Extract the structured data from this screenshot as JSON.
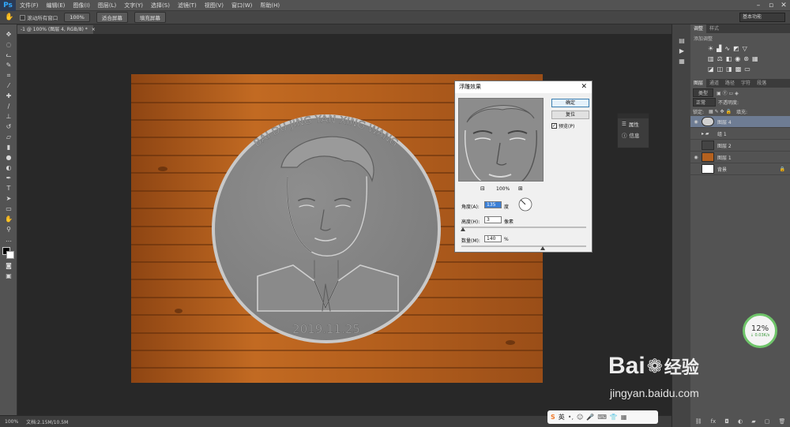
{
  "app": {
    "logo": "Ps"
  },
  "menu": [
    "文件(F)",
    "编辑(E)",
    "图像(I)",
    "图层(L)",
    "文字(Y)",
    "选择(S)",
    "滤镜(T)",
    "视图(V)",
    "窗口(W)",
    "帮助(H)"
  ],
  "options_bar": {
    "scroll_all_label": "滚动所有窗口",
    "btn_100": "100%",
    "btn_fit": "适合屏幕",
    "btn_fill": "填充屏幕",
    "workspace": "基本功能"
  },
  "document": {
    "tab": "-1 @ 100% (图层 4, RGB/8) *"
  },
  "coin": {
    "top_text": "BAI DU JING YAN XING WANG",
    "date": "2019.11.25"
  },
  "dialog": {
    "title": "浮雕效果",
    "ok": "确定",
    "reset": "复位",
    "preview_label": "预览(P)",
    "preview_checked": true,
    "zoom": "100%",
    "angle_label": "角度(A):",
    "angle_value": "135",
    "angle_unit": "度",
    "height_label": "高度(H):",
    "height_value": "3",
    "height_unit": "像素",
    "amount_label": "数量(M):",
    "amount_value": "140",
    "amount_unit": "%",
    "height_slider_fraction": 0.01,
    "amount_slider_fraction": 0.65
  },
  "side_panel": {
    "properties": "属性",
    "info": "信息"
  },
  "panels": {
    "adjust_tabs": [
      "调整",
      "样式"
    ],
    "adjust_hint": "添加调整",
    "layer_tabs": [
      "图层",
      "通道",
      "路径",
      "字符",
      "段落"
    ],
    "kind": "类型",
    "blend": "正常",
    "opacity_label": "不透明度:",
    "lock_label": "锁定:",
    "fill_label": "填充:",
    "layers": [
      {
        "name": "图层 4",
        "selected": true,
        "visible": true
      },
      {
        "name": "组 1",
        "selected": false,
        "visible": false
      },
      {
        "name": "图层 2",
        "selected": false,
        "visible": false
      },
      {
        "name": "图层 1",
        "selected": false,
        "visible": true
      },
      {
        "name": "背景",
        "selected": false,
        "visible": false
      }
    ]
  },
  "status": {
    "zoom": "100%",
    "doc": "文档:2.15M/10.5M"
  },
  "net_widget": {
    "percent": "12%",
    "speed": "↓ 0.03K/s"
  },
  "watermark": {
    "brand": "Bai",
    "brand_cn": "经验",
    "url": "jingyan.baidu.com"
  },
  "ime": {
    "lang": "英"
  },
  "colors": {
    "accent_green": "#6fc46a",
    "selected_layer": "#6e7c93",
    "dialog_bg": "#f0f0f0",
    "wood": "#b4611f",
    "coin": "#8a8a8a"
  }
}
